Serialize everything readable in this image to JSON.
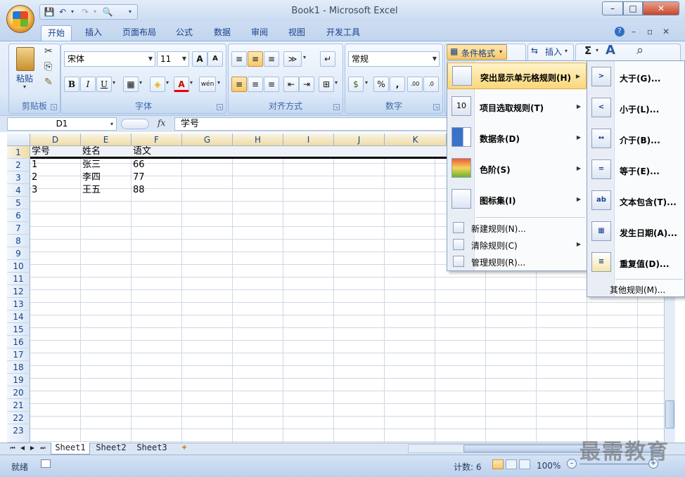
{
  "window": {
    "title": "Book1 - Microsoft Excel"
  },
  "qat": {
    "save": "💾",
    "undo": "↶",
    "undo_arrow": "▾",
    "redo": "↷",
    "redo_arrow": "▾",
    "print": "🔍",
    "more": "▾"
  },
  "window_controls": {
    "minimize": "–",
    "maximize": "□",
    "close": "✕"
  },
  "ribbon_tabs": [
    "开始",
    "插入",
    "页面布局",
    "公式",
    "数据",
    "审阅",
    "视图",
    "开发工具"
  ],
  "ribbon_tab_controls": {
    "help": "?",
    "minimize": "–",
    "restore": "▫",
    "close": "✕"
  },
  "groups": {
    "clipboard": {
      "label": "剪贴板",
      "paste": "粘贴",
      "paste_arrow": "▾",
      "cut": "✂",
      "copy": "⎘",
      "format_painter": "✎"
    },
    "font": {
      "label": "字体",
      "font_name": "宋体",
      "font_size": "11",
      "grow": "A",
      "shrink": "A",
      "bold": "B",
      "italic": "I",
      "underline": "U",
      "underline_arrow": "▾",
      "border": "▦",
      "border_arrow": "▾",
      "fill": "◈",
      "fill_arrow": "▾",
      "color": "A",
      "color_arrow": "▾",
      "phonetic": "wén",
      "phonetic_arrow": "▾"
    },
    "alignment": {
      "label": "对齐方式",
      "top": "≡",
      "middle": "≡",
      "bottom": "≡",
      "orientation": "≫",
      "orientation_arrow": "▾",
      "wrap": "↵",
      "left": "≡",
      "center": "≡",
      "right": "≡",
      "outdent": "⇤",
      "indent": "⇥",
      "merge": "⊞",
      "merge_arrow": "▾"
    },
    "number": {
      "label": "数字",
      "format": "常规",
      "currency": "$",
      "currency_arrow": "▾",
      "percent": "%",
      "comma": ",",
      "inc_dec": ".00",
      "dec_dec": ".0"
    },
    "styles": {
      "conditional_format": "条件格式",
      "cf_arrow": "▾",
      "cf_icon": "▦"
    },
    "cells": {
      "insert": "插入",
      "insert_arrow": "▾",
      "insert_icon": "⇆"
    },
    "editing": {
      "sum": "Σ",
      "sum_arrow": "▾",
      "sort": "A",
      "find": "⌕"
    }
  },
  "formula_bar": {
    "name_box": "D1",
    "name_arrow": "▾",
    "fx": "fx",
    "formula": "学号"
  },
  "columns": [
    "D",
    "E",
    "F",
    "G",
    "H",
    "I",
    "J",
    "K"
  ],
  "rows": [
    "1",
    "2",
    "3",
    "4",
    "5",
    "6",
    "7",
    "8",
    "9",
    "10",
    "11",
    "12",
    "13",
    "14",
    "15",
    "16",
    "17",
    "18",
    "19",
    "20",
    "21",
    "22",
    "23"
  ],
  "data": [
    [
      "学号",
      "姓名",
      "语文"
    ],
    [
      "1",
      "张三",
      "66"
    ],
    [
      "2",
      "李四",
      "77"
    ],
    [
      "3",
      "王五",
      "88"
    ]
  ],
  "sheet_nav": {
    "first": "⏮",
    "prev": "◀",
    "next": "▶",
    "last": "⏭"
  },
  "sheets": [
    "Sheet1",
    "Sheet2",
    "Sheet3"
  ],
  "new_sheet": "✦",
  "status": {
    "ready": "就绪",
    "count": "计数: 6",
    "zoom": "100%",
    "zoom_out": "–",
    "zoom_in": "+"
  },
  "cf_menu": {
    "items": [
      {
        "label": "突出显示单元格规则(H)",
        "icon": "highlight-cells-icon",
        "sub": "▶"
      },
      {
        "label": "项目选取规则(T)",
        "icon": "top-bottom-icon",
        "sub": "▶"
      },
      {
        "label": "数据条(D)",
        "icon": "data-bars-icon",
        "sub": "▶"
      },
      {
        "label": "色阶(S)",
        "icon": "color-scale-icon",
        "sub": "▶"
      },
      {
        "label": "图标集(I)",
        "icon": "icon-sets-icon",
        "sub": "▶"
      }
    ],
    "small": [
      {
        "label": "新建规则(N)...",
        "icon": "new-rule-icon"
      },
      {
        "label": "清除规则(C)",
        "icon": "clear-rules-icon",
        "sub": "▶"
      },
      {
        "label": "管理规则(R)...",
        "icon": "manage-rules-icon"
      }
    ],
    "top_bottom_number": "10"
  },
  "hl_menu": {
    "items": [
      {
        "label": "大于(G)...",
        "glyph": ">"
      },
      {
        "label": "小于(L)...",
        "glyph": "<"
      },
      {
        "label": "介于(B)...",
        "glyph": "↔"
      },
      {
        "label": "等于(E)...",
        "glyph": "="
      },
      {
        "label": "文本包含(T)...",
        "glyph": "ab"
      },
      {
        "label": "发生日期(A)...",
        "glyph": "▦"
      },
      {
        "label": "重复值(D)...",
        "glyph": "≡"
      }
    ],
    "more": "其他规则(M)..."
  },
  "watermark": "最需教育"
}
